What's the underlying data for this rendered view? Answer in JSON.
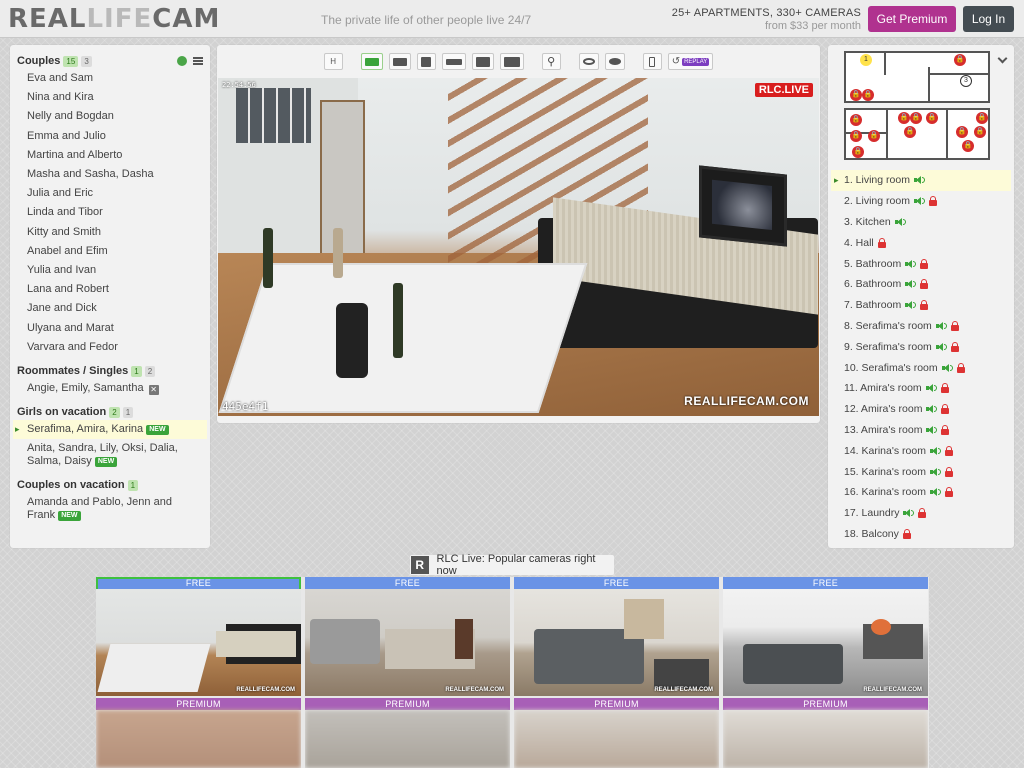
{
  "header": {
    "logo_real": "REAL",
    "logo_life": "LIFE",
    "logo_cam": "CAM",
    "tagline": "The private life of other people live 24/7",
    "promo_line1": "25+ APARTMENTS, 330+ CAMERAS",
    "promo_line2": "from $33 per month",
    "premium_button": "Get Premium",
    "login_button": "Log In"
  },
  "sidebar": {
    "groups": [
      {
        "title": "Couples",
        "count_online": "15",
        "count_offline": "3",
        "items": [
          {
            "label": "Eva and Sam"
          },
          {
            "label": "Nina and Kira"
          },
          {
            "label": "Nelly and Bogdan"
          },
          {
            "label": "Emma and Julio"
          },
          {
            "label": "Martina and Alberto"
          },
          {
            "label": "Masha and Sasha, Dasha"
          },
          {
            "label": "Julia and Eric"
          },
          {
            "label": "Linda and Tibor"
          },
          {
            "label": "Kitty and Smith"
          },
          {
            "label": "Anabel and Efim"
          },
          {
            "label": "Yulia and Ivan"
          },
          {
            "label": "Lana and Robert"
          },
          {
            "label": "Jane and Dick"
          },
          {
            "label": "Ulyana and Marat"
          },
          {
            "label": "Varvara and Fedor"
          }
        ]
      },
      {
        "title": "Roommates / Singles",
        "count_online": "1",
        "count_offline": "2",
        "items": [
          {
            "label": "Angie, Emily, Samantha"
          }
        ]
      },
      {
        "title": "Girls on vacation",
        "count_online": "2",
        "count_offline": "1",
        "items": [
          {
            "label": "Serafima, Amira, Karina",
            "new": "NEW"
          },
          {
            "label": "Anita, Sandra, Lily, Oksi, Dalia, Salma, Daisy",
            "new": "NEW"
          }
        ]
      },
      {
        "title": "Couples on vacation",
        "count_online": "1",
        "items": [
          {
            "label": "Amanda and Pablo, Jenn and Frank",
            "new": "NEW"
          }
        ]
      }
    ]
  },
  "player": {
    "toolbar": {
      "hd_label": "H",
      "replay_label": "REPLAY"
    },
    "timestamp": "22:54:56",
    "live_badge": "RLC.LIVE",
    "watermark": "REALLIFECAM.COM",
    "stream_id": "445e4f1"
  },
  "cameras": [
    {
      "label": "1. Living room",
      "audio": true,
      "locked": false,
      "active": true
    },
    {
      "label": "2. Living room",
      "audio": true,
      "locked": true
    },
    {
      "label": "3. Kitchen",
      "audio": true,
      "locked": false
    },
    {
      "label": "4. Hall",
      "audio": false,
      "locked": true
    },
    {
      "label": "5. Bathroom",
      "audio": true,
      "locked": true
    },
    {
      "label": "6. Bathroom",
      "audio": true,
      "locked": true
    },
    {
      "label": "7. Bathroom",
      "audio": true,
      "locked": true
    },
    {
      "label": "8. Serafima's room",
      "audio": true,
      "locked": true
    },
    {
      "label": "9. Serafima's room",
      "audio": true,
      "locked": true
    },
    {
      "label": "10. Serafima's room",
      "audio": true,
      "locked": true
    },
    {
      "label": "11. Amira's room",
      "audio": true,
      "locked": true
    },
    {
      "label": "12. Amira's room",
      "audio": true,
      "locked": true
    },
    {
      "label": "13. Amira's room",
      "audio": true,
      "locked": true
    },
    {
      "label": "14. Karina's room",
      "audio": true,
      "locked": true
    },
    {
      "label": "15. Karina's room",
      "audio": true,
      "locked": true
    },
    {
      "label": "16. Karina's room",
      "audio": true,
      "locked": true
    },
    {
      "label": "17. Laundry",
      "audio": true,
      "locked": true
    },
    {
      "label": "18. Balcony",
      "audio": false,
      "locked": true
    }
  ],
  "floorplan": {
    "pins_top": [
      "1",
      "3"
    ]
  },
  "popular": {
    "icon_letter": "R",
    "title": "RLC Live: Popular cameras right now",
    "free_label": "FREE",
    "premium_label": "PREMIUM",
    "watermark": "REALLIFECAM.COM"
  },
  "colors": {
    "premium_button": "#b0328f",
    "login_button": "#444c52",
    "free_label": "#6a93e6",
    "premium_label": "#a85fb7",
    "active_highlight": "#fdfbd8",
    "live_badge": "#d81e1e",
    "online_badge": "#bfe3b0",
    "new_tag": "#3aa43a"
  },
  "icons": [
    "add-camera-icon",
    "menu-icon",
    "speaker-icon",
    "lock-icon",
    "eye-icon",
    "motion-icon",
    "replay-icon",
    "chevron-down-icon",
    "close-icon"
  ]
}
